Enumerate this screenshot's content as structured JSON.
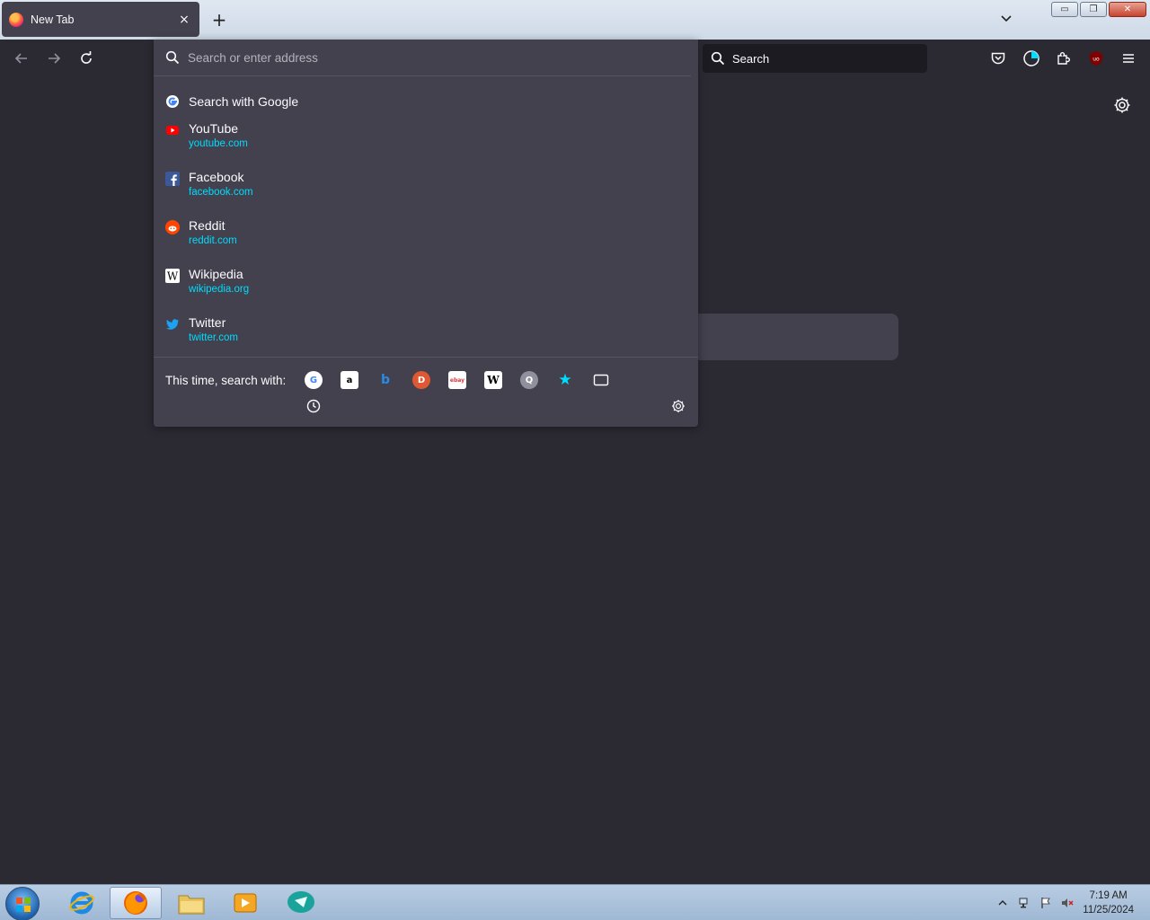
{
  "tab": {
    "title": "New Tab",
    "close": "×"
  },
  "newtab": "+",
  "window_controls": {
    "minimize": "▭",
    "maximize": "❐",
    "close": "✕"
  },
  "urlbar": {
    "placeholder": "Search or enter address",
    "results": [
      {
        "title": "Search with Google",
        "icon": "google-icon"
      },
      {
        "title": "YouTube",
        "url": "youtube.com",
        "icon": "youtube-icon"
      },
      {
        "title": "Facebook",
        "url": "facebook.com",
        "icon": "facebook-icon"
      },
      {
        "title": "Reddit",
        "url": "reddit.com",
        "icon": "reddit-icon"
      },
      {
        "title": "Wikipedia",
        "url": "wikipedia.org",
        "icon": "wikipedia-icon"
      },
      {
        "title": "Twitter",
        "url": "twitter.com",
        "icon": "twitter-icon"
      }
    ],
    "oneoff_label": "This time, search with:",
    "engines": [
      {
        "name": "google",
        "glyph": "G"
      },
      {
        "name": "amazon",
        "glyph": "a"
      },
      {
        "name": "bing",
        "glyph": "b"
      },
      {
        "name": "duckduckgo",
        "glyph": "D"
      },
      {
        "name": "ebay",
        "glyph": "ebay"
      },
      {
        "name": "wikipedia",
        "glyph": "W"
      },
      {
        "name": "search-engine",
        "glyph": "Q"
      },
      {
        "name": "bookmarks",
        "glyph": "★"
      },
      {
        "name": "tabs",
        "glyph": ""
      }
    ]
  },
  "search": {
    "placeholder": "Search"
  },
  "clock": {
    "time": "7:19 AM",
    "date": "11/25/2024"
  },
  "colors": {
    "accent_url": "#00ddff",
    "panel": "#42414d",
    "background": "#2b2a33"
  }
}
